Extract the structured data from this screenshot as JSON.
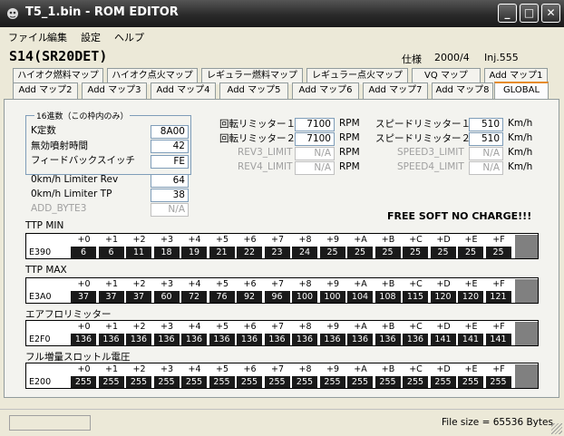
{
  "window": {
    "title": "T5_1.bin - ROM EDITOR"
  },
  "menu": [
    "ファイル",
    "編集",
    "設定",
    "ヘルプ"
  ],
  "header": {
    "car": "S14(SR20DET)",
    "spec_label": "仕様",
    "spec_value": "2000/4",
    "inj": "Inj.555"
  },
  "tabs": {
    "row1": [
      "ハイオク燃料マップ",
      "ハイオク点火マップ",
      "レギュラー燃料マップ",
      "レギュラー点火マップ",
      "VQ マップ",
      "Add マップ1"
    ],
    "row2": [
      "Add マップ2",
      "Add マップ3",
      "Add マップ4",
      "Add マップ5",
      "Add マップ6",
      "Add マップ7",
      "Add マップ8",
      "GLOBAL"
    ],
    "active": "GLOBAL"
  },
  "group": {
    "legend": "16進数（この枠内のみ）"
  },
  "fields": {
    "k_const": {
      "label": "K定数",
      "value": "8A00"
    },
    "invalid_time": {
      "label": "無効噴射時間",
      "value": "42"
    },
    "feedback": {
      "label": "フィードバックスイッチ",
      "value": "FE"
    },
    "limiter_rev": {
      "label": "0km/h Limiter Rev",
      "value": "64"
    },
    "limiter_tp": {
      "label": "0km/h Limiter TP",
      "value": "38"
    },
    "add_byte3": {
      "label": "ADD_BYTE3",
      "value": "N/A"
    }
  },
  "limiters": {
    "rev1": {
      "label": "回転リミッター１",
      "value": "7100",
      "unit": "RPM"
    },
    "rev2": {
      "label": "回転リミッター２",
      "value": "7100",
      "unit": "RPM"
    },
    "rev3": {
      "label": "REV3_LIMIT",
      "value": "N/A",
      "unit": "RPM"
    },
    "rev4": {
      "label": "REV4_LIMIT",
      "value": "N/A",
      "unit": "RPM"
    },
    "spd1": {
      "label": "スピードリミッター１",
      "value": "510",
      "unit": "Km/h"
    },
    "spd2": {
      "label": "スピードリミッター２",
      "value": "510",
      "unit": "Km/h"
    },
    "spd3": {
      "label": "SPEED3_LIMIT",
      "value": "N/A",
      "unit": "Km/h"
    },
    "spd4": {
      "label": "SPEED4_LIMIT",
      "value": "N/A",
      "unit": "Km/h"
    }
  },
  "free_text": "FREE SOFT  NO CHARGE!!!",
  "table_headers": [
    "+0",
    "+1",
    "+2",
    "+3",
    "+4",
    "+5",
    "+6",
    "+7",
    "+8",
    "+9",
    "+A",
    "+B",
    "+C",
    "+D",
    "+E",
    "+F"
  ],
  "tables": [
    {
      "title": "TTP MIN",
      "addr": "E390",
      "values": [
        "6",
        "6",
        "11",
        "18",
        "19",
        "21",
        "22",
        "23",
        "24",
        "25",
        "25",
        "25",
        "25",
        "25",
        "25",
        "25"
      ]
    },
    {
      "title": "TTP MAX",
      "addr": "E3A0",
      "values": [
        "37",
        "37",
        "37",
        "60",
        "72",
        "76",
        "92",
        "96",
        "100",
        "100",
        "104",
        "108",
        "115",
        "120",
        "120",
        "121"
      ]
    },
    {
      "title": "エアフロリミッター",
      "addr": "E2F0",
      "values": [
        "136",
        "136",
        "136",
        "136",
        "136",
        "136",
        "136",
        "136",
        "136",
        "136",
        "136",
        "136",
        "136",
        "141",
        "141",
        "141"
      ]
    },
    {
      "title": "フル増量スロットル電圧",
      "addr": "E200",
      "values": [
        "255",
        "255",
        "255",
        "255",
        "255",
        "255",
        "255",
        "255",
        "255",
        "255",
        "255",
        "255",
        "255",
        "255",
        "255",
        "255"
      ]
    }
  ],
  "status": {
    "file_size": "File size =  65536 Bytes"
  }
}
